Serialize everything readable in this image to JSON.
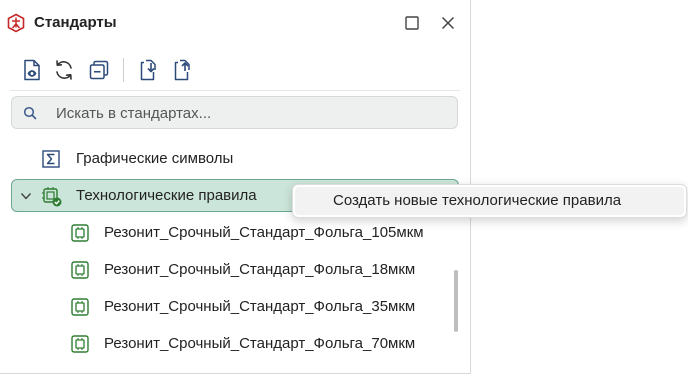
{
  "window": {
    "title": "Стандарты",
    "icons": {
      "app": "standards-icon",
      "maximize": "maximize-icon",
      "close": "close-icon"
    }
  },
  "toolbar": {
    "buttons": [
      {
        "name": "view-document",
        "icon": "document-eye-icon"
      },
      {
        "name": "refresh",
        "icon": "refresh-icon"
      },
      {
        "name": "collapse-all",
        "icon": "collapse-all-icon"
      },
      {
        "name": "import",
        "icon": "import-icon"
      },
      {
        "name": "export",
        "icon": "export-icon"
      }
    ]
  },
  "search": {
    "placeholder": "Искать в стандартах...",
    "value": ""
  },
  "tree": {
    "items": [
      {
        "label": "Графические символы",
        "icon": "sigma-icon",
        "level": 0,
        "expanded": false,
        "selected": false
      },
      {
        "label": "Технологические правила",
        "icon": "chip-check-icon",
        "level": 0,
        "expanded": true,
        "selected": true
      },
      {
        "label": "Резонит_Срочный_Стандарт_Фольга_105мкм",
        "icon": "chip-icon",
        "level": 1
      },
      {
        "label": "Резонит_Срочный_Стандарт_Фольга_18мкм",
        "icon": "chip-icon",
        "level": 1
      },
      {
        "label": "Резонит_Срочный_Стандарт_Фольга_35мкм",
        "icon": "chip-icon",
        "level": 1
      },
      {
        "label": "Резонит_Срочный_Стандарт_Фольга_70мкм",
        "icon": "chip-icon",
        "level": 1
      }
    ]
  },
  "context_menu": {
    "items": [
      {
        "label": "Создать новые технологические правила"
      }
    ]
  },
  "colors": {
    "selection_bg": "#cce5da",
    "selection_border": "#6ea892",
    "icon_blue": "#2c4a7a",
    "icon_green": "#2e7d32",
    "app_icon_red": "#c62828"
  }
}
